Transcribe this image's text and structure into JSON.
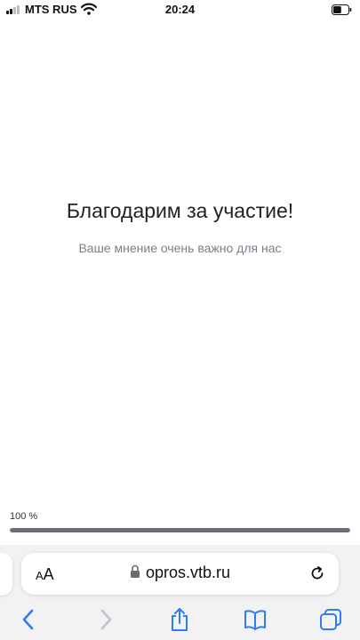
{
  "status_bar": {
    "carrier": "MTS RUS",
    "time": "20:24",
    "battery_level": 0.55
  },
  "main": {
    "title": "Благодарим за участие!",
    "subtitle": "Ваше мнение очень важно для нас"
  },
  "progress": {
    "label": "100 %",
    "value": 1.0
  },
  "browser": {
    "text_size_small": "A",
    "text_size_large": "A",
    "url": "opros.vtb.ru"
  },
  "colors": {
    "accent": "#2f7cf6",
    "progress_fill": "#6e6e7a",
    "subtitle": "#7b7f89"
  },
  "icons": [
    "signal-icon",
    "wifi-icon",
    "battery-icon",
    "lock-icon",
    "reload-icon",
    "back-icon",
    "forward-icon",
    "share-icon",
    "bookmarks-icon",
    "tabs-icon"
  ]
}
